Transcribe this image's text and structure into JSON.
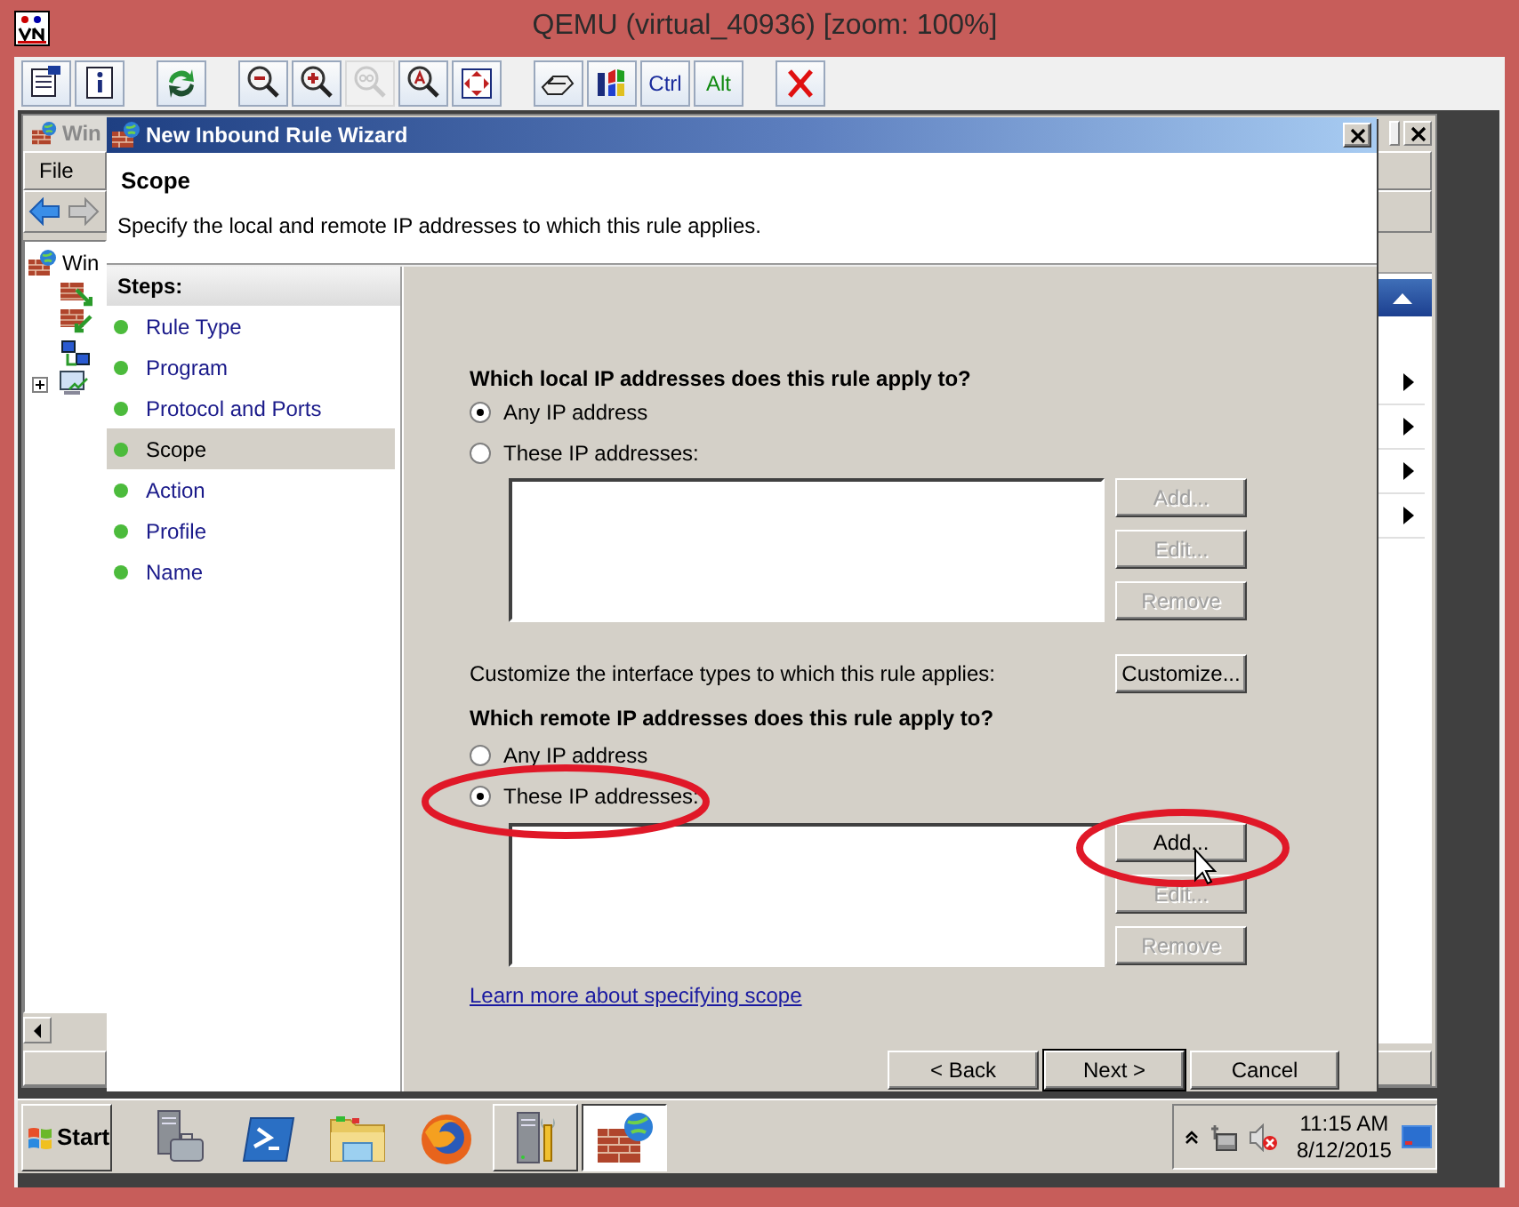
{
  "host_window": {
    "title": "QEMU (virtual_40936) [zoom: 100%]"
  },
  "toolbar": [
    {
      "kind": "icon",
      "disabled": false
    },
    {
      "kind": "icon",
      "disabled": false
    },
    {
      "kind": "icon",
      "disabled": false
    },
    {
      "kind": "icon",
      "disabled": false
    },
    {
      "kind": "icon",
      "disabled": false
    },
    {
      "kind": "icon",
      "disabled": true
    },
    {
      "kind": "icon",
      "disabled": false
    },
    {
      "kind": "icon",
      "disabled": false
    },
    {
      "kind": "icon",
      "disabled": false
    },
    {
      "kind": "icon",
      "disabled": false
    },
    {
      "kind": "text",
      "label": "Ctrl",
      "disabled": false
    },
    {
      "kind": "text",
      "label": "Alt",
      "disabled": false
    },
    {
      "kind": "icon",
      "disabled": false
    }
  ],
  "background_window": {
    "title": "Win",
    "menu": [
      "File"
    ],
    "tree_root": "Win"
  },
  "wizard": {
    "title": "New Inbound Rule Wizard",
    "heading": "Scope",
    "subtitle": "Specify the local and remote IP addresses to which this rule applies.",
    "steps_title": "Steps:",
    "steps": [
      {
        "label": "Rule Type",
        "selected": false
      },
      {
        "label": "Program",
        "selected": false
      },
      {
        "label": "Protocol and Ports",
        "selected": false
      },
      {
        "label": "Scope",
        "selected": true
      },
      {
        "label": "Action",
        "selected": false
      },
      {
        "label": "Profile",
        "selected": false
      },
      {
        "label": "Name",
        "selected": false
      }
    ],
    "local": {
      "question": "Which local IP addresses does this rule apply to?",
      "options": [
        {
          "label": "Any IP address",
          "selected": true
        },
        {
          "label": "These IP addresses:",
          "selected": false
        }
      ],
      "buttons": [
        {
          "label": "Add...",
          "disabled": true
        },
        {
          "label": "Edit...",
          "disabled": true
        },
        {
          "label": "Remove",
          "disabled": true
        }
      ]
    },
    "customize": {
      "text": "Customize the interface types to which this rule applies:",
      "button": "Customize..."
    },
    "remote": {
      "question": "Which remote IP addresses does this rule apply to?",
      "options": [
        {
          "label": "Any IP address",
          "selected": false
        },
        {
          "label": "These IP addresses:",
          "selected": true
        }
      ],
      "buttons": [
        {
          "label": "Add...",
          "disabled": false
        },
        {
          "label": "Edit...",
          "disabled": true
        },
        {
          "label": "Remove",
          "disabled": true
        }
      ]
    },
    "link": "Learn more about specifying scope",
    "nav_buttons": [
      {
        "label": "< Back",
        "default": false
      },
      {
        "label": "Next >",
        "default": true
      },
      {
        "label": "Cancel",
        "default": false
      }
    ]
  },
  "taskbar": {
    "start": "Start",
    "apps": [
      {
        "open": false,
        "selected": false
      },
      {
        "open": false,
        "selected": false
      },
      {
        "open": false,
        "selected": false
      },
      {
        "open": false,
        "selected": false
      },
      {
        "open": true,
        "selected": false
      },
      {
        "open": true,
        "selected": true
      }
    ],
    "clock": {
      "time": "11:15 AM",
      "date": "8/12/2015"
    }
  }
}
